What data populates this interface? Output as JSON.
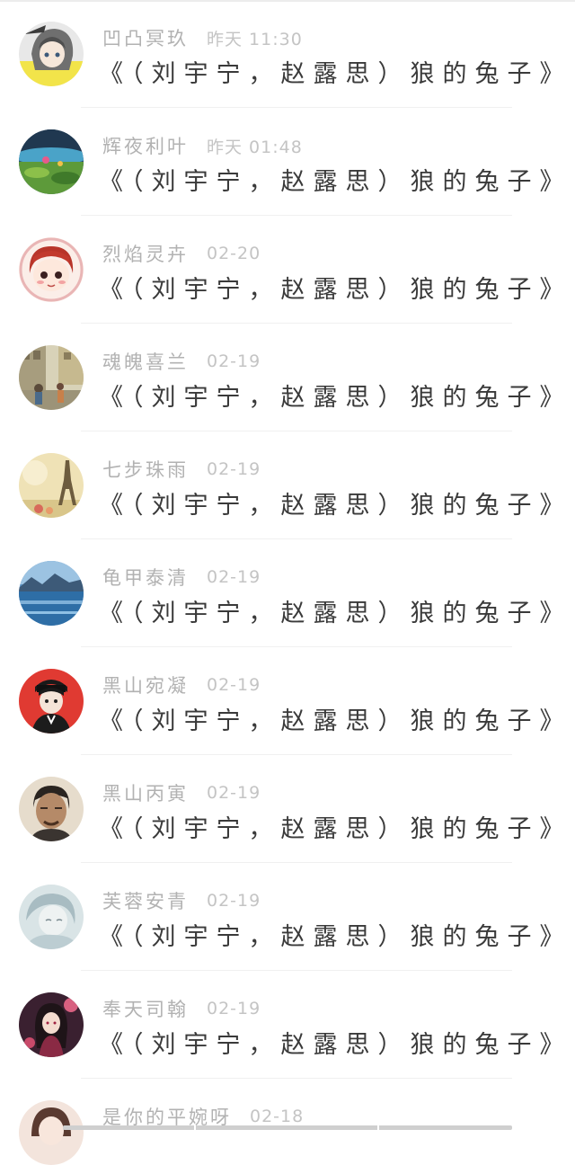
{
  "comments": [
    {
      "name": "凹凸冥玖",
      "time": "昨天 11:30",
      "text": "《（刘宇宁，赵露思）狼的兔子》",
      "avatar": "avatar-anime-girl-icon"
    },
    {
      "name": "辉夜利叶",
      "time": "昨天 01:48",
      "text": "《（刘宇宁，赵露思）狼的兔子》",
      "avatar": "avatar-landscape-icon"
    },
    {
      "name": "烈焰灵卉",
      "time": "02-20",
      "text": "《（刘宇宁，赵露思）狼的兔子》",
      "avatar": "avatar-cartoon-girl-icon"
    },
    {
      "name": "魂魄喜兰",
      "time": "02-19",
      "text": "《（刘宇宁，赵露思）狼的兔子》",
      "avatar": "avatar-street-scene-icon"
    },
    {
      "name": "七步珠雨",
      "time": "02-19",
      "text": "《（刘宇宁，赵露思）狼的兔子》",
      "avatar": "avatar-eiffel-tower-icon"
    },
    {
      "name": "龟甲泰清",
      "time": "02-19",
      "text": "《（刘宇宁，赵露思）狼的兔子》",
      "avatar": "avatar-lake-icon"
    },
    {
      "name": "黑山宛凝",
      "time": "02-19",
      "text": "《（刘宇宁，赵露思）狼的兔子》",
      "avatar": "avatar-red-anime-boy-icon"
    },
    {
      "name": "黑山丙寅",
      "time": "02-19",
      "text": "《（刘宇宁，赵露思）狼的兔子》",
      "avatar": "avatar-man-portrait-icon"
    },
    {
      "name": "芙蓉安青",
      "time": "02-19",
      "text": "《（刘宇宁，赵露思）狼的兔子》",
      "avatar": "avatar-sketch-girl-icon"
    },
    {
      "name": "奉天司翰",
      "time": "02-19",
      "text": "《（刘宇宁，赵露思）狼的兔子》",
      "avatar": "avatar-dark-girl-icon"
    }
  ],
  "partial_comment": {
    "name": "是你的平婉呀",
    "time": "02-18",
    "avatar": "avatar-girl-photo-icon"
  },
  "colors": {
    "name": "#b2b2b2",
    "time": "#c4c4c4",
    "text": "#3a3a3a",
    "divider": "#f0f0f0"
  }
}
